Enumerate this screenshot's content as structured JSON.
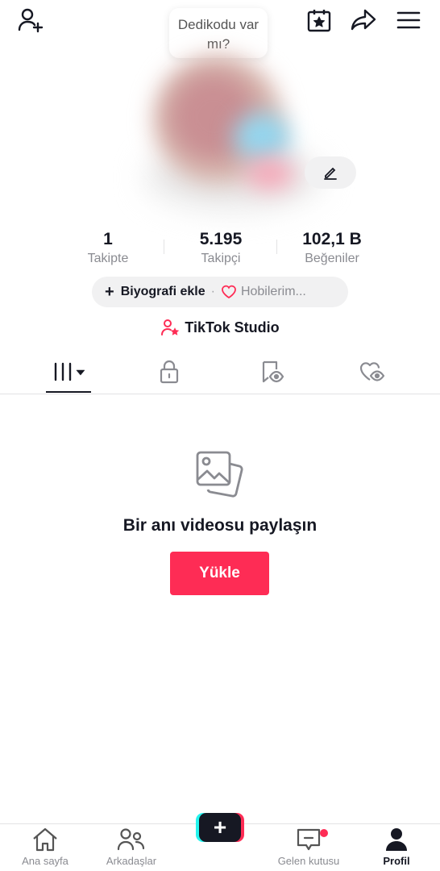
{
  "header": {
    "gossip_bubble_text": "Dedikodu var mı?"
  },
  "stats": {
    "following": {
      "value": "1",
      "label": "Takipte"
    },
    "followers": {
      "value": "5.195",
      "label": "Takipçi"
    },
    "likes": {
      "value": "102,1 B",
      "label": "Beğeniler"
    }
  },
  "bio": {
    "add_label": "Biyografi ekle",
    "separator": "·",
    "hobbies_label": "Hobilerim..."
  },
  "studio": {
    "label": "TikTok Studio"
  },
  "empty_state": {
    "title": "Bir anı videosu paylaşın",
    "upload_label": "Yükle"
  },
  "bottom_nav": {
    "home": "Ana sayfa",
    "friends": "Arkadaşlar",
    "inbox": "Gelen kutusu",
    "profile": "Profil",
    "create_symbol": "+"
  },
  "colors": {
    "accent": "#fe2c55",
    "cyan": "#25f4ee",
    "text": "#161823",
    "muted": "#8a8b91"
  },
  "icons": [
    "add-friend-icon",
    "calendar-star-icon",
    "share-icon",
    "menu-icon",
    "pencil-icon",
    "grid-videos-icon",
    "lock-icon",
    "repost-eye-icon",
    "liked-heart-icon",
    "photos-icon",
    "home-icon",
    "friends-icon",
    "inbox-icon",
    "profile-icon"
  ]
}
